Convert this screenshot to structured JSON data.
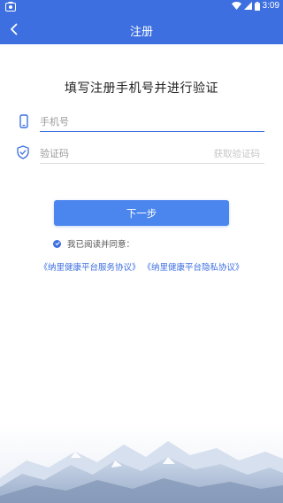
{
  "status_bar": {
    "time": "3:09",
    "left_icon": "screenshot-icon",
    "icons": [
      "wifi-icon",
      "signal-icon",
      "battery-icon"
    ]
  },
  "nav": {
    "title": "注册",
    "back_icon": "chevron-left-icon"
  },
  "heading": "填写注册手机号并进行验证",
  "phone_field": {
    "icon": "phone-icon",
    "placeholder": "手机号",
    "value": ""
  },
  "code_field": {
    "icon": "shield-check-icon",
    "placeholder": "验证码",
    "value": "",
    "get_code_label": "获取验证码"
  },
  "next_button": "下一步",
  "agreement": {
    "checked": true,
    "text": "我已阅读并同意：",
    "service_link": "《纳里健康平台服务协议》",
    "privacy_link": "《纳里健康平台隐私协议》"
  },
  "colors": {
    "primary": "#3d6fe0",
    "button": "#4a86ee",
    "text_dark": "#222222",
    "placeholder": "#9a9a9a",
    "disabled_text": "#c6c6c6"
  }
}
